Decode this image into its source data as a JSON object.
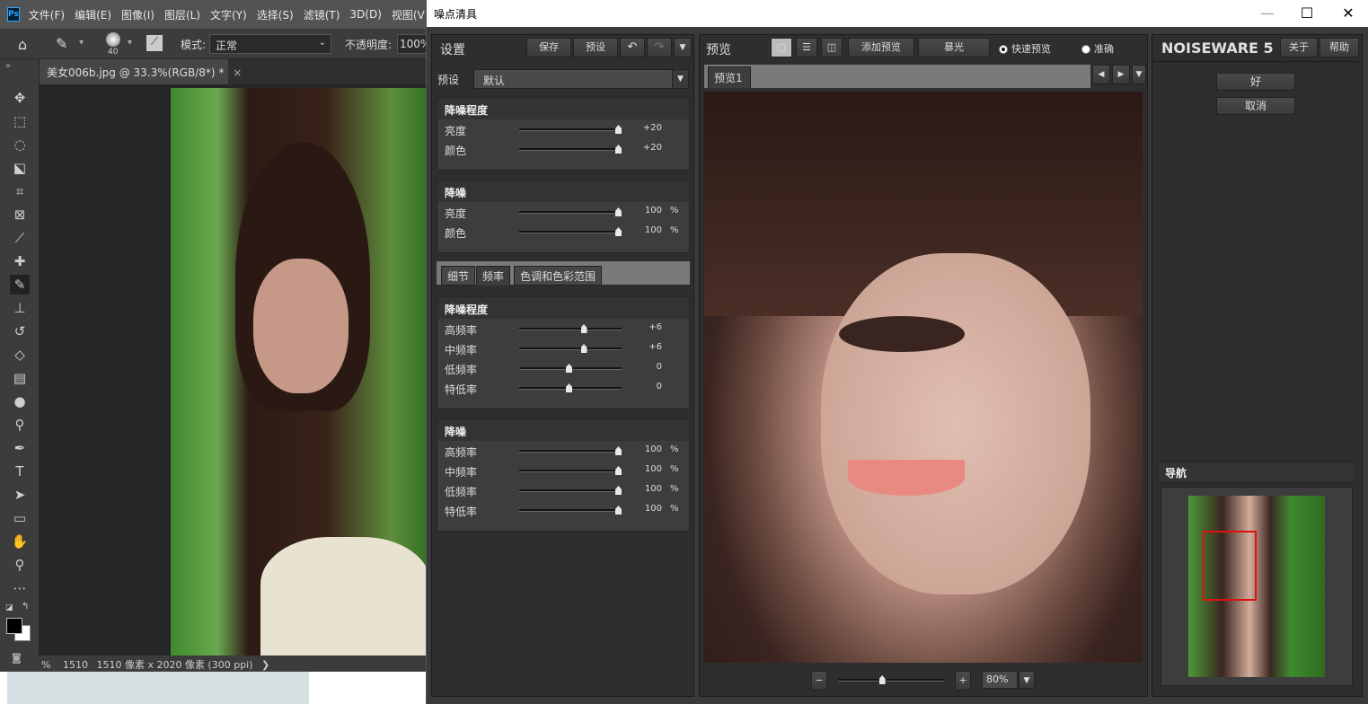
{
  "photoshop": {
    "logo": "Ps",
    "menu": [
      "文件(F)",
      "编辑(E)",
      "图像(I)",
      "图层(L)",
      "文字(Y)",
      "选择(S)",
      "滤镜(T)",
      "3D(D)",
      "视图(V)"
    ],
    "options": {
      "brush_size": "40",
      "mode_label": "模式:",
      "mode_value": "正常",
      "opacity_label": "不透明度:",
      "opacity_value": "100%"
    },
    "doc_tab": "美女006b.jpg @ 33.3%(RGB/8*) *",
    "doc_tab_close": "×",
    "status": {
      "zoom_suffix": "%",
      "zoom_value": "1510",
      "info": "1510 像素 x 2020 像素 (300 ppi)",
      "arrow": "❯"
    }
  },
  "dialog": {
    "title": "噪点清具",
    "settings": {
      "title": "设置",
      "save": "保存",
      "preset_btn": "预设",
      "preset_label": "预设",
      "preset_value": "默认"
    },
    "groups": [
      {
        "title": "降噪程度",
        "rows": [
          {
            "label": "亮度",
            "value": "+20",
            "unit": "",
            "pos": 1.0
          },
          {
            "label": "颜色",
            "value": "+20",
            "unit": "",
            "pos": 1.0
          }
        ]
      },
      {
        "title": "降噪",
        "rows": [
          {
            "label": "亮度",
            "value": "100",
            "unit": "%",
            "pos": 1.0
          },
          {
            "label": "颜色",
            "value": "100",
            "unit": "%",
            "pos": 1.0
          }
        ]
      }
    ],
    "tabs": [
      "细节",
      "频率",
      "色调和色彩范围"
    ],
    "freq_groups": [
      {
        "title": "降噪程度",
        "rows": [
          {
            "label": "高频率",
            "value": "+6",
            "unit": "",
            "pos": 0.65
          },
          {
            "label": "中频率",
            "value": "+6",
            "unit": "",
            "pos": 0.65
          },
          {
            "label": "低频率",
            "value": "0",
            "unit": "",
            "pos": 0.5
          },
          {
            "label": "特低率",
            "value": "0",
            "unit": "",
            "pos": 0.5
          }
        ]
      },
      {
        "title": "降噪",
        "rows": [
          {
            "label": "高频率",
            "value": "100",
            "unit": "%",
            "pos": 1.0
          },
          {
            "label": "中频率",
            "value": "100",
            "unit": "%",
            "pos": 1.0
          },
          {
            "label": "低频率",
            "value": "100",
            "unit": "%",
            "pos": 1.0
          },
          {
            "label": "特低率",
            "value": "100",
            "unit": "%",
            "pos": 1.0
          }
        ]
      }
    ],
    "preview": {
      "title": "预览",
      "add_preview": "添加预览",
      "exposure": "暴光",
      "fast_preview": "快速预览",
      "accurate": "准确",
      "tab": "预览1",
      "zoom": "80%",
      "zoom_minus": "−",
      "zoom_plus": "+",
      "zoom_slider_pos": 0.4
    },
    "right": {
      "brand": "NOISEWARE 5",
      "about": "关于",
      "help": "帮助",
      "ok": "好",
      "cancel": "取消",
      "nav_title": "导航"
    }
  }
}
